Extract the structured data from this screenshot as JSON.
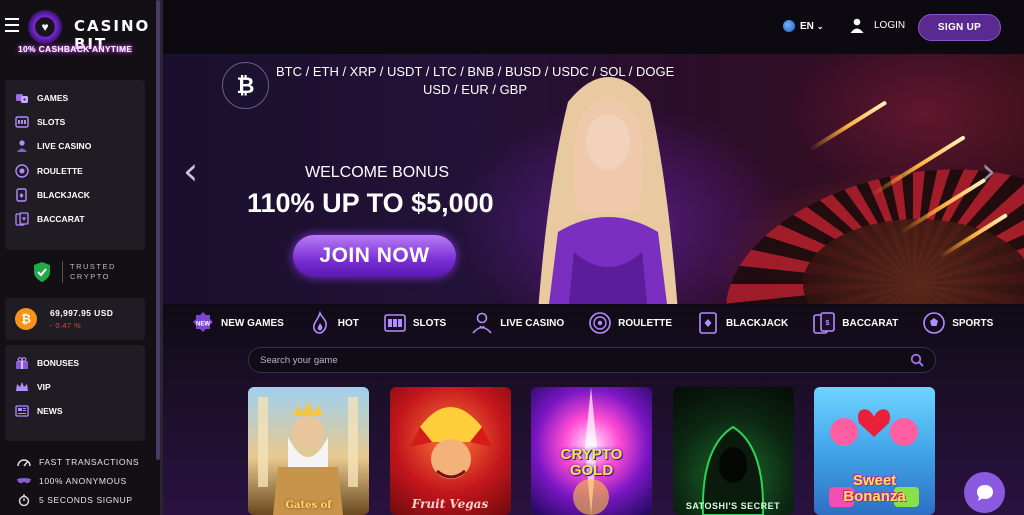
{
  "brand": {
    "name": "CASINO BIT",
    "tagline": "10% CASHBACK ANYTIME"
  },
  "sidebar": {
    "games": [
      {
        "label": "GAMES",
        "icon": "dice-icon"
      },
      {
        "label": "SLOTS",
        "icon": "slot-machine-icon"
      },
      {
        "label": "LIVE CASINO",
        "icon": "dealer-icon"
      },
      {
        "label": "ROULETTE",
        "icon": "roulette-icon"
      },
      {
        "label": "BLACKJACK",
        "icon": "cards-icon"
      },
      {
        "label": "BACCARAT",
        "icon": "baccarat-icon"
      }
    ],
    "trusted": {
      "line1": "TRUSTED",
      "line2": "CRYPTO"
    },
    "balance": {
      "amount": "69,997.95 USD",
      "change": "- 0.47 %"
    },
    "extra": [
      {
        "label": "BONUSES",
        "icon": "gift-icon"
      },
      {
        "label": "VIP",
        "icon": "crown-icon"
      },
      {
        "label": "NEWS",
        "icon": "news-icon"
      }
    ],
    "perks": [
      {
        "label": "FAST TRANSACTIONS",
        "icon": "speed-icon"
      },
      {
        "label": "100% ANONYMOUS",
        "icon": "mask-icon"
      },
      {
        "label": "5 SECONDS SIGNUP",
        "icon": "stopwatch-icon"
      }
    ]
  },
  "header": {
    "language": "EN",
    "login": "LOGIN",
    "signup": "SIGN UP"
  },
  "banner": {
    "currencies_line1": "BTC / ETH / XRP / USDT / LTC / BNB / BUSD / USDC / SOL / DOGE",
    "currencies_line2": "USD / EUR / GBP",
    "welcome": "WELCOME BONUS",
    "title": "110% UP TO $5,000",
    "cta": "JOIN NOW"
  },
  "categories": [
    {
      "label": "NEW GAMES",
      "icon": "new-badge-icon"
    },
    {
      "label": "HOT",
      "icon": "flame-icon"
    },
    {
      "label": "SLOTS",
      "icon": "slot-machine-icon"
    },
    {
      "label": "LIVE CASINO",
      "icon": "dealer-icon"
    },
    {
      "label": "ROULETTE",
      "icon": "roulette-icon"
    },
    {
      "label": "BLACKJACK",
      "icon": "cards-icon"
    },
    {
      "label": "BACCARAT",
      "icon": "baccarat-icon"
    },
    {
      "label": "SPORTS",
      "icon": "soccer-ball-icon"
    }
  ],
  "search": {
    "placeholder": "Search your game"
  },
  "games": [
    {
      "title": "Gates of"
    },
    {
      "title": "Fruit Vegas"
    },
    {
      "title": "CRYPTO GOLD"
    },
    {
      "title": "SATOSHI'S SECRET"
    },
    {
      "title": "Sweet Bonanza"
    }
  ],
  "colors": {
    "accent": "#5b2a91",
    "cta": "#8b3ee6",
    "negative": "#ff3b3b",
    "bitcoin": "#f7931a"
  }
}
